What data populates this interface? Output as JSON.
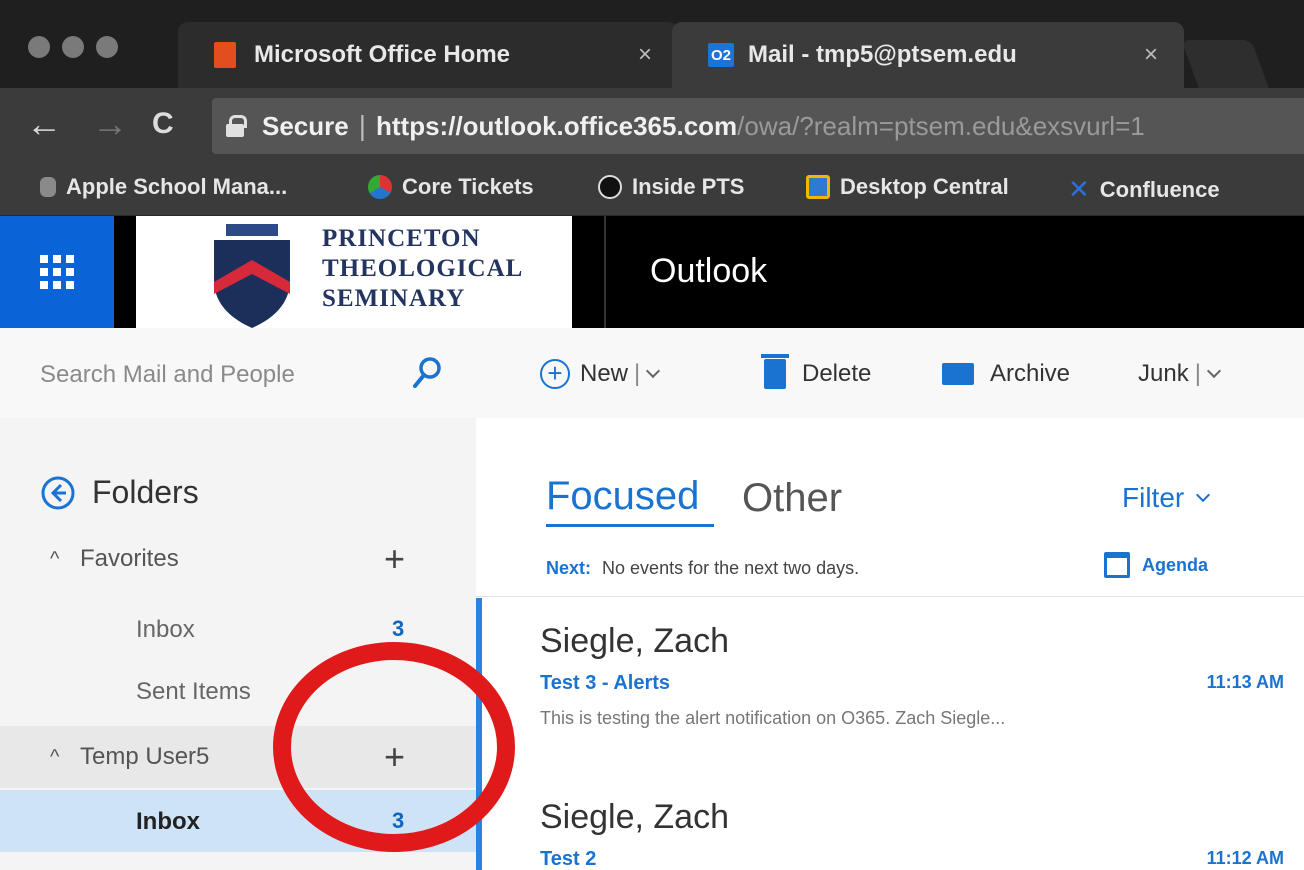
{
  "browser": {
    "tabs": [
      {
        "title": "Microsoft Office Home",
        "close": "×"
      },
      {
        "title": "Mail - tmp5@ptsem.edu",
        "favicon_text": "O2",
        "close": "×"
      }
    ],
    "nav": {
      "back": "←",
      "forward": "→",
      "reload": "C"
    },
    "address": {
      "secure_label": "Secure",
      "separator": "|",
      "url_main": "https://outlook.office365.com",
      "url_rest": "/owa/?realm=ptsem.edu&exsvurl=1"
    },
    "bookmarks": [
      {
        "label": "Apple School Mana...",
        "icon": "apple-icon"
      },
      {
        "label": "Core Tickets",
        "icon": "core-tickets-icon"
      },
      {
        "label": "Inside PTS",
        "icon": "inside-pts-icon"
      },
      {
        "label": "Desktop Central",
        "icon": "desktop-central-icon"
      },
      {
        "label": "Confluence",
        "icon": "confluence-icon"
      }
    ]
  },
  "header": {
    "seminary_line1": "PRINCETON",
    "seminary_line2": "THEOLOGICAL",
    "seminary_line3": "SEMINARY",
    "app_name": "Outlook"
  },
  "search": {
    "placeholder": "Search Mail and People"
  },
  "commands": {
    "new_label": "New",
    "split": "|",
    "delete_label": "Delete",
    "archive_label": "Archive",
    "junk_label": "Junk"
  },
  "folders": {
    "title": "Folders",
    "favorites": {
      "label": "Favorites",
      "items": [
        {
          "label": "Inbox",
          "count": "3"
        },
        {
          "label": "Sent Items",
          "count": ""
        }
      ]
    },
    "account": {
      "label": "Temp User5",
      "items": [
        {
          "label": "Inbox",
          "count": "3"
        }
      ]
    },
    "caret": "^",
    "plus": "+"
  },
  "list": {
    "tab_focused": "Focused",
    "tab_other": "Other",
    "filter_label": "Filter",
    "next_label": "Next:",
    "next_text": "No events for the next two days.",
    "agenda_label": "Agenda",
    "messages": [
      {
        "sender": "Siegle, Zach",
        "subject": "Test 3 - Alerts",
        "time": "11:13 AM",
        "preview": "This is testing the alert notification on O365. Zach Siegle..."
      },
      {
        "sender": "Siegle, Zach",
        "subject": "Test 2",
        "time": "11:12 AM",
        "preview": ""
      }
    ]
  },
  "colors": {
    "accent": "#1a73d0",
    "waffle": "#0a64d8",
    "annotation": "#e01a1a",
    "selected_folder": "#cfe3f7"
  }
}
